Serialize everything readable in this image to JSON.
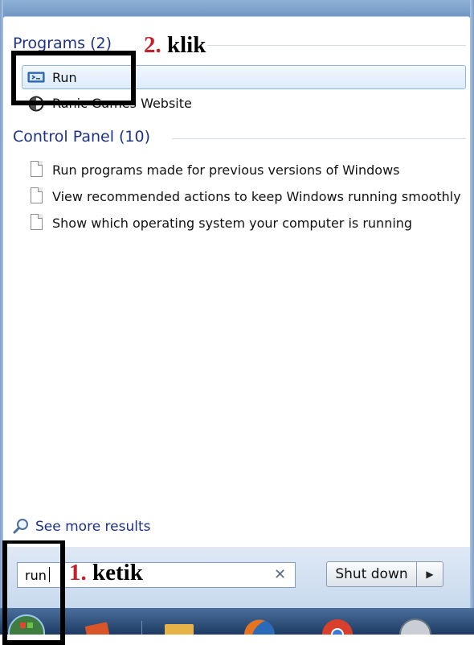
{
  "programs": {
    "header": "Programs (2)",
    "items": [
      {
        "label": "Run",
        "icon": "run-icon"
      },
      {
        "label": "Runic Games Website",
        "icon": "globe-icon"
      }
    ]
  },
  "control_panel": {
    "header": "Control Panel (10)",
    "items": [
      {
        "label": "Run programs made for previous versions of Windows",
        "icon": "document-icon"
      },
      {
        "label": "View recommended actions to keep Windows running smoothly",
        "icon": "document-icon"
      },
      {
        "label": "Show which operating system your computer is running",
        "icon": "document-icon"
      }
    ]
  },
  "see_more": {
    "label": "See more results",
    "icon": "magnifier-icon"
  },
  "search": {
    "value": "run",
    "clear_icon": "clear-icon"
  },
  "shutdown": {
    "label": "Shut down",
    "arrow_icon": "chevron-right-icon"
  },
  "annotations": {
    "click": {
      "number": "2.",
      "text": "klik"
    },
    "type": {
      "number": "1.",
      "text": "ketik"
    }
  },
  "colors": {
    "header_blue": "#1e3287",
    "annotation_red": "#c0222e",
    "highlight_border": "#8fb7e6"
  }
}
